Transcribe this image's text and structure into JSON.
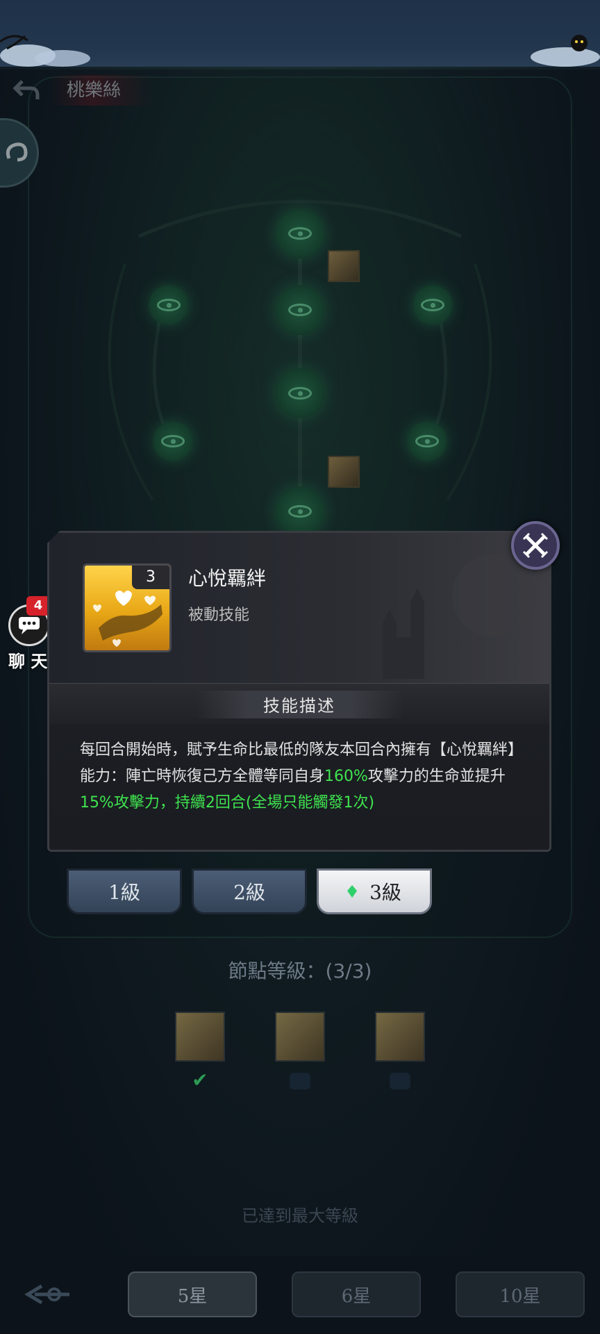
{
  "header": {
    "character_name": "桃樂絲",
    "back_icon": "back-arrow-icon"
  },
  "popup": {
    "skill_name": "心悅羈絆",
    "skill_type": "被動技能",
    "skill_level_tag": "3",
    "section_title": "技能描述",
    "description": {
      "part1": "每回合開始時，賦予生命比最低的隊友本回合內擁有【心悅羈絆】能力：陣亡時恢復己方全體等同自身",
      "hl1": "160%",
      "part2": "攻擊力的生命並提升",
      "hl2": "15%攻擊力，持續2回合(全場只能觸發1次)"
    },
    "close_icon": "close-icon"
  },
  "chat": {
    "count": "4",
    "label": "聊 天"
  },
  "level_tabs": [
    {
      "label": "1級"
    },
    {
      "label": "2級"
    },
    {
      "label": "3級"
    }
  ],
  "node_level": "節點等級：(3/3)",
  "max_level_text": "已達到最大等級",
  "star_tabs": [
    {
      "label": "5星"
    },
    {
      "label": "6星"
    },
    {
      "label": "10星"
    }
  ],
  "colors": {
    "highlight": "#3fe34f",
    "chat_badge": "#d6222a"
  }
}
